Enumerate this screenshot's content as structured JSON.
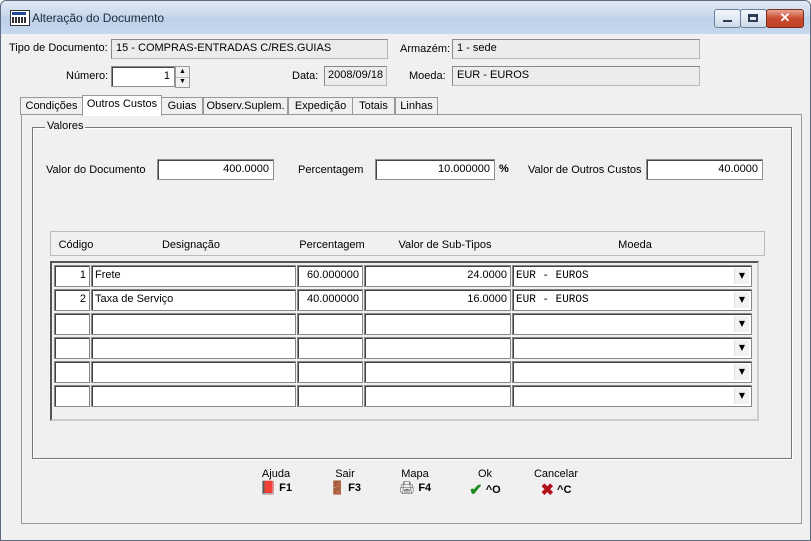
{
  "window": {
    "title": "Alteração do Documento"
  },
  "header": {
    "tipo_label": "Tipo de Documento:",
    "tipo_value": "15 - COMPRAS-ENTRADAS C/RES.GUIAS",
    "armazem_label": "Armazém:",
    "armazem_value": "1 - sede",
    "numero_label": "Número:",
    "numero_value": "1",
    "data_label": "Data:",
    "data_value": "2008/09/18",
    "moeda_label": "Moeda:",
    "moeda_value": "EUR - EUROS"
  },
  "tabs": [
    {
      "label": "Condições"
    },
    {
      "label": "Outros Custos",
      "active": true
    },
    {
      "label": "Guias"
    },
    {
      "label": "Observ.Suplem."
    },
    {
      "label": "Expedição"
    },
    {
      "label": "Totais"
    },
    {
      "label": "Linhas"
    }
  ],
  "valores": {
    "group_title": "Valores",
    "valor_documento_label": "Valor do Documento",
    "valor_documento_value": "400.0000",
    "percentagem_label": "Percentagem",
    "percentagem_value": "10.000000",
    "percent_symbol": "%",
    "valor_outros_custos_label": "Valor de Outros Custos",
    "valor_outros_custos_value": "40.0000"
  },
  "grid": {
    "columns": [
      "Código",
      "Designação",
      "Percentagem",
      "Valor de Sub-Tipos",
      "Moeda"
    ],
    "rows": [
      {
        "codigo": "1",
        "designacao": "Frete",
        "percentagem": "60.000000",
        "valor": "24.0000",
        "moeda": "EUR - EUROS"
      },
      {
        "codigo": "2",
        "designacao": "Taxa de Serviço",
        "percentagem": "40.000000",
        "valor": "16.0000",
        "moeda": "EUR - EUROS"
      },
      {
        "codigo": "",
        "designacao": "",
        "percentagem": "",
        "valor": "",
        "moeda": ""
      },
      {
        "codigo": "",
        "designacao": "",
        "percentagem": "",
        "valor": "",
        "moeda": ""
      },
      {
        "codigo": "",
        "designacao": "",
        "percentagem": "",
        "valor": "",
        "moeda": ""
      },
      {
        "codigo": "",
        "designacao": "",
        "percentagem": "",
        "valor": "",
        "moeda": ""
      }
    ]
  },
  "buttons": [
    {
      "label": "Ajuda",
      "key": "F1",
      "icon": "book-icon",
      "color": "#8a2b8c"
    },
    {
      "label": "Sair",
      "key": "F3",
      "icon": "exit-door-icon",
      "color": "#1c3f8c"
    },
    {
      "label": "Mapa",
      "key": "F4",
      "icon": "printer-icon",
      "color": "#555555"
    },
    {
      "label": "Ok",
      "key": "^O",
      "icon": "checkmark-icon",
      "color": "#1f8a1f"
    },
    {
      "label": "Cancelar",
      "key": "^C",
      "icon": "cross-icon",
      "color": "#b3121c"
    }
  ]
}
